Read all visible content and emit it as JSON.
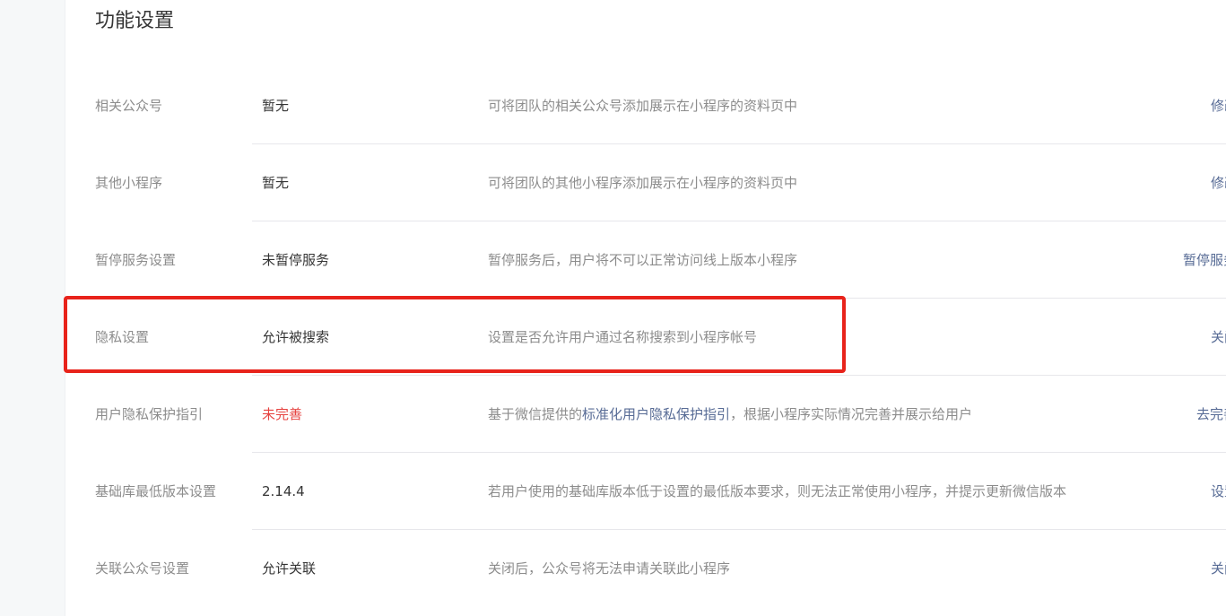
{
  "page": {
    "section_title": "功能设置"
  },
  "rows": [
    {
      "label": "相关公众号",
      "value": "暂无",
      "description": "可将团队的相关公众号添加展示在小程序的资料页中",
      "action": "修改"
    },
    {
      "label": "其他小程序",
      "value": "暂无",
      "description": "可将团队的其他小程序添加展示在小程序的资料页中",
      "action": "修改"
    },
    {
      "label": "暂停服务设置",
      "value": "未暂停服务",
      "description": "暂停服务后，用户将不可以正常访问线上版本小程序",
      "action": "暂停服务"
    },
    {
      "label": "隐私设置",
      "value": "允许被搜索",
      "description": "设置是否允许用户通过名称搜索到小程序帐号",
      "action": "关闭"
    },
    {
      "label": "用户隐私保护指引",
      "value": "未完善",
      "description_before": "基于微信提供的",
      "description_link": "标准化用户隐私保护指引",
      "description_after": "，根据小程序实际情况完善并展示给用户",
      "action": "去完善"
    },
    {
      "label": "基础库最低版本设置",
      "value": "2.14.4",
      "description": "若用户使用的基础库版本低于设置的最低版本要求，则无法正常使用小程序，并提示更新微信版本",
      "action": "设置"
    },
    {
      "label": "关联公众号设置",
      "value": "允许关联",
      "description": "关闭后，公众号将无法申请关联此小程序",
      "action": "关闭"
    }
  ],
  "colors": {
    "accent_link": "#576b95",
    "warning": "#e64340",
    "highlight_border": "#e8231b"
  }
}
